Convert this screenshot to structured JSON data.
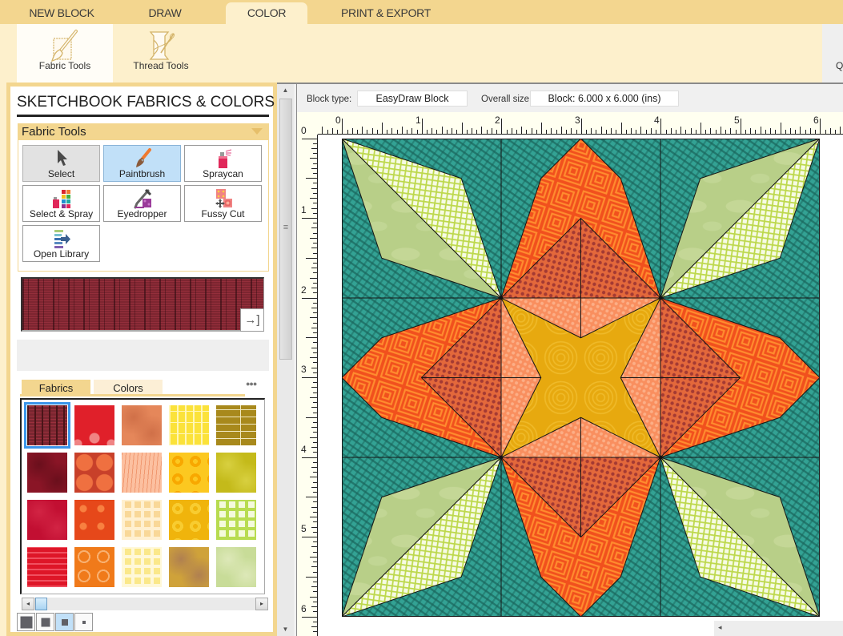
{
  "ribbon": {
    "tabs": [
      {
        "label": "NEW BLOCK"
      },
      {
        "label": "DRAW"
      },
      {
        "label": "COLOR",
        "active": true
      },
      {
        "label": "PRINT & EXPORT"
      }
    ],
    "tools": [
      {
        "label": "Fabric Tools",
        "icon": "fabric-brush-icon",
        "selected": true
      },
      {
        "label": "Thread Tools",
        "icon": "thread-spool-icon",
        "selected": false
      }
    ],
    "overflow_text": "Q"
  },
  "panel": {
    "title": "SKETCHBOOK FABRICS & COLORS",
    "section_title": "Fabric Tools",
    "tools": [
      {
        "label": "Select",
        "icon": "arrow-cursor-icon",
        "state": "pressed"
      },
      {
        "label": "Paintbrush",
        "icon": "paintbrush-icon",
        "state": "active"
      },
      {
        "label": "Spraycan",
        "icon": "spraycan-icon",
        "state": "normal"
      },
      {
        "label": "Select & Spray",
        "icon": "select-spray-icon",
        "state": "normal"
      },
      {
        "label": "Eyedropper",
        "icon": "eyedropper-icon",
        "state": "normal"
      },
      {
        "label": "Fussy Cut",
        "icon": "fussy-cut-icon",
        "state": "normal"
      },
      {
        "label": "Open Library",
        "icon": "open-library-icon",
        "state": "normal"
      }
    ],
    "preview": {
      "fabric_color": "#7d2530",
      "expand_glyph": "→]"
    },
    "fabric_tabs": [
      {
        "label": "Fabrics",
        "active": true
      },
      {
        "label": "Colors",
        "active": false
      }
    ],
    "more_glyph": "●●●",
    "selected_swatch": 0,
    "swatches": [
      {
        "base": "#7a2630",
        "accent": "#4a1418",
        "pattern": "plaid"
      },
      {
        "base": "#e0202a",
        "accent": "#f08484",
        "pattern": "flower"
      },
      {
        "base": "#e5875a",
        "accent": "#d07048",
        "pattern": "mottled"
      },
      {
        "base": "#fbe23a",
        "accent": "#fff6b8",
        "pattern": "grid-lines"
      },
      {
        "base": "#a8891c",
        "accent": "#f0e8c0",
        "pattern": "lines"
      },
      {
        "base": "#8a1526",
        "accent": "#6a0f1c",
        "pattern": "mottled"
      },
      {
        "base": "#c8402a",
        "accent": "#ef7040",
        "pattern": "circles"
      },
      {
        "base": "#fcc0a0",
        "accent": "#f09870",
        "pattern": "stripes"
      },
      {
        "base": "#fcc820",
        "accent": "#f8a800",
        "pattern": "rings"
      },
      {
        "base": "#c4ba1a",
        "accent": "#d8d040",
        "pattern": "mottled"
      },
      {
        "base": "#c20f32",
        "accent": "#d22444",
        "pattern": "mottled"
      },
      {
        "base": "#e6481a",
        "accent": "#f88040",
        "pattern": "dots"
      },
      {
        "base": "#f9d898",
        "accent": "#fff0d0",
        "pattern": "check"
      },
      {
        "base": "#f0b40c",
        "accent": "#f8cc30",
        "pattern": "rings"
      },
      {
        "base": "#f4fadc",
        "accent": "#b8dc50",
        "pattern": "check"
      },
      {
        "base": "#de1628",
        "accent": "#f05060",
        "pattern": "stripes-h"
      },
      {
        "base": "#f07a1a",
        "accent": "#f8b070",
        "pattern": "ring-outline"
      },
      {
        "base": "#fbe88a",
        "accent": "#fff8d8",
        "pattern": "check"
      },
      {
        "base": "#cfa23a",
        "accent": "#b08050",
        "pattern": "mottled"
      },
      {
        "base": "#c8dc98",
        "accent": "#dde8b8",
        "pattern": "mottled"
      }
    ],
    "swatch_scroll_left_glyph": "◂",
    "swatch_scroll_right_glyph": "▸",
    "view_sizes": [
      {
        "name": "extra-large",
        "active": false
      },
      {
        "name": "large",
        "active": false
      },
      {
        "name": "medium",
        "active": true
      },
      {
        "name": "small",
        "active": false
      }
    ],
    "scroll_up_glyph": "▲",
    "scroll_down_glyph": "▼",
    "scroll_grip_glyph": "≡"
  },
  "canvas": {
    "block_type_label": "Block type:",
    "block_type_value": "EasyDraw Block",
    "overall_size_label": "Overall size:",
    "overall_size_value": "Block: 6.000 x 6.000 (ins)",
    "ruler": {
      "units": "inches",
      "h_labels": [
        "0",
        "1",
        "2",
        "3",
        "4",
        "5",
        "6"
      ],
      "v_labels": [
        "0",
        "1",
        "2",
        "3",
        "4",
        "5",
        "6"
      ]
    },
    "scroll_left_glyph": "◂",
    "block": {
      "width_in": 6,
      "height_in": 6,
      "fabrics": {
        "background": {
          "base": "#33a294",
          "accent": "#1a665c"
        },
        "petal": {
          "base": "#f1501d",
          "accent": "#ff8c2e"
        },
        "petal_center": {
          "base": "#e3683b",
          "accent": "#a43a33"
        },
        "center_square": {
          "base": "#f98f5f",
          "accent": "#fcae86"
        },
        "star": {
          "base": "#e7a90f",
          "accent": "#f3c236"
        },
        "leaf_solid": {
          "base": "#b8cf88",
          "accent": "#cfe0a4"
        },
        "leaf_check": {
          "base": "#f6fbe4",
          "accent": "#bdd84c"
        }
      }
    }
  }
}
